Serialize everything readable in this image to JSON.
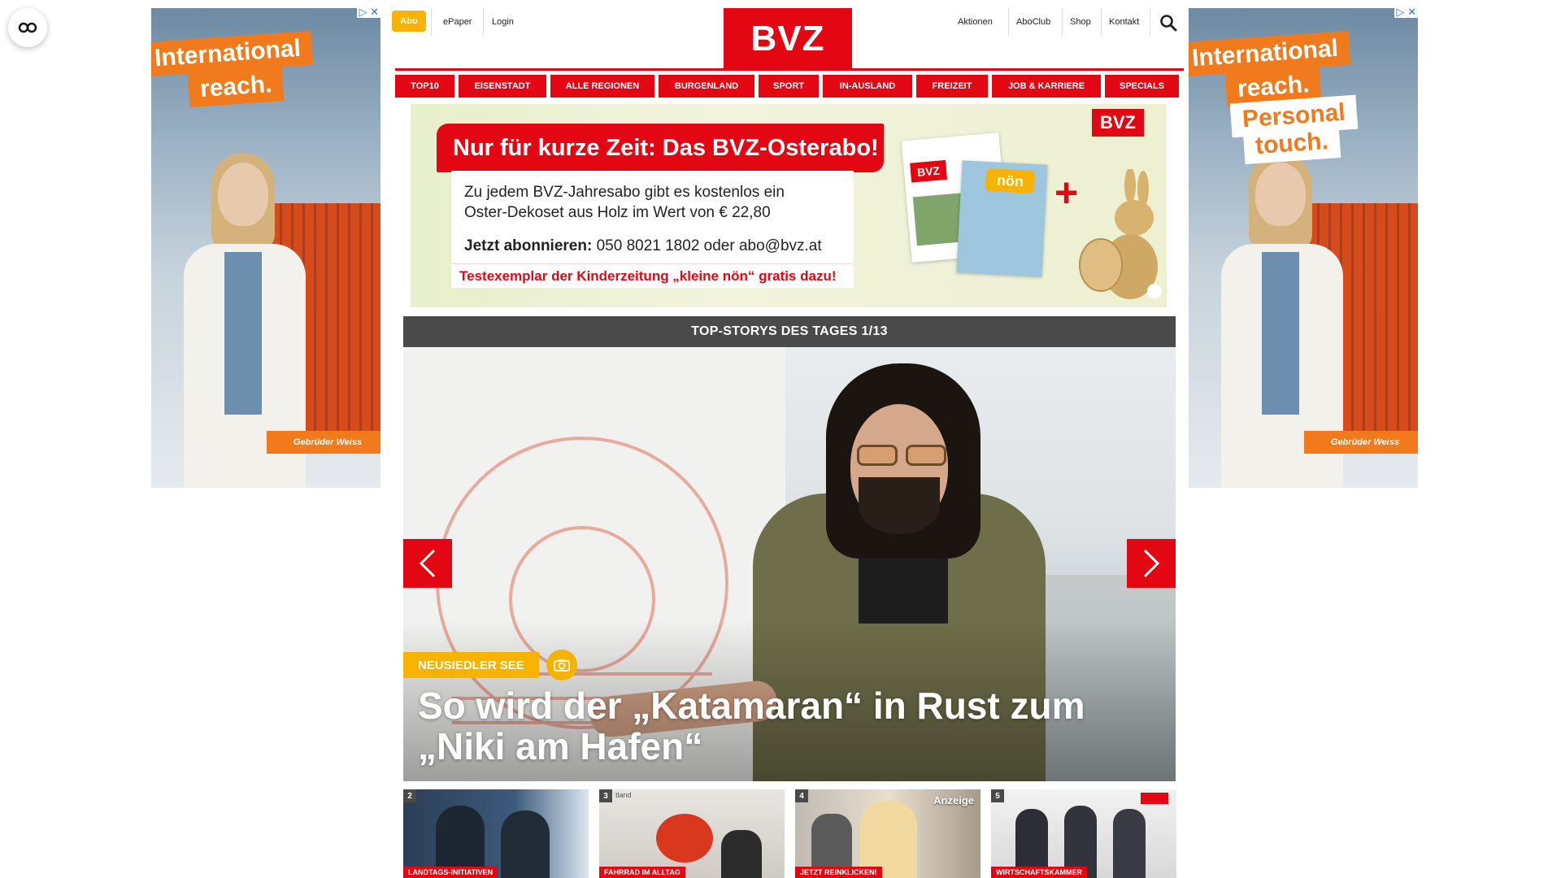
{
  "accessibility": {
    "icon": "accessibility-icon"
  },
  "ads": {
    "close_label": "▷ ✕",
    "left": {
      "band1": "International",
      "band2": "reach.",
      "logo": "Gebrüder Weiss"
    },
    "right": {
      "band1": "International",
      "band2": "reach.",
      "band3": "Personal",
      "band4": "touch.",
      "logo": "Gebrüder Weiss"
    }
  },
  "header": {
    "abo": "Abo",
    "epaper": "ePaper",
    "login": "Login",
    "logo": "BVZ",
    "right_links": [
      "Aktionen",
      "AboClub",
      "Shop",
      "Kontakt"
    ],
    "search_icon": "search-icon"
  },
  "nav": [
    "TOP10",
    "EISENSTADT",
    "ALLE REGIONEN",
    "BURGENLAND",
    "SPORT",
    "IN-AUSLAND",
    "FREIZEIT",
    "JOB & KARRIERE",
    "SPECIALS"
  ],
  "promo": {
    "title": "Nur für kurze Zeit: Das BVZ-Osterabo!",
    "line1": "Zu jedem BVZ-Jahresabo gibt es kostenlos ein",
    "line2": "Oster-Dekoset aus Holz im Wert von € 22,80",
    "cta_bold": "Jetzt abonnieren:",
    "cta_rest": " 050 8021 1802 oder abo@bvz.at",
    "test": "Testexemplar der Kinderzeitung „kleine nön“ gratis dazu!",
    "logo": "BVZ",
    "mag1": "BVZ",
    "mag2": "nön",
    "plus": "+"
  },
  "top_stories": {
    "header": "TOP-STORYS DES TAGES 1/13",
    "tag": "NEUSIEDLER SEE",
    "title": "So wird der „Katamaran“ in Rust zum „Niki am Hafen“",
    "prev_icon": "chevron-left-icon",
    "next_icon": "chevron-right-icon",
    "camera_icon": "camera-icon"
  },
  "thumbs": [
    {
      "num": "2",
      "caption": "LANDTAGS-INITIATIVEN",
      "extra": ""
    },
    {
      "num": "3",
      "caption": "FAHRRAD IM ALLTAG",
      "extra": "",
      "faint": "tland"
    },
    {
      "num": "4",
      "caption": "JETZT REINKLICKEN!",
      "extra": "Anzeige"
    },
    {
      "num": "5",
      "caption": "WIRTSCHAFTSKAMMER",
      "extra": ""
    }
  ],
  "colors": {
    "brand_red": "#e30613",
    "accent_yellow": "#f8b300",
    "ad_orange": "#f07a1c",
    "dark_header": "#4a4a4a"
  }
}
